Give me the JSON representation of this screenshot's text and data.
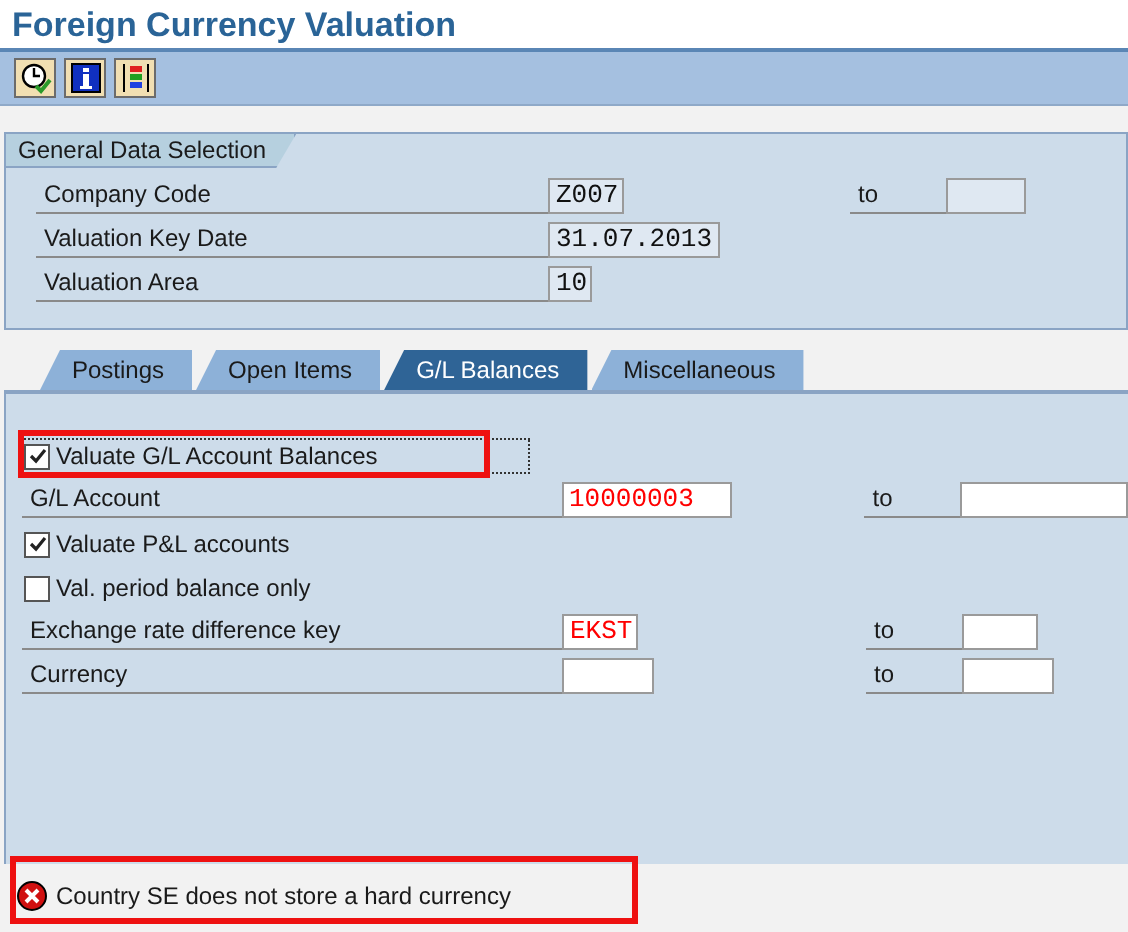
{
  "title": "Foreign Currency Valuation",
  "toolbar": [
    {
      "kind": "execute"
    },
    {
      "kind": "info"
    },
    {
      "kind": "layout"
    }
  ],
  "general_data_selection": {
    "title": "General Data Selection",
    "rows": [
      {
        "label": "Company Code",
        "value": "Z007",
        "to": {
          "label": "to"
        }
      },
      {
        "label": "Valuation Key Date",
        "value": "31.07.2013"
      },
      {
        "label": "Valuation Area",
        "value": "10"
      }
    ]
  },
  "tabs": [
    {
      "label": "Postings",
      "selected": false
    },
    {
      "label": "Open Items",
      "selected": false
    },
    {
      "label": "G/L Balances",
      "selected": true
    },
    {
      "label": "Miscellaneous",
      "selected": false
    }
  ],
  "gl_balances": [
    {
      "kind": "checkbox",
      "label": "Valuate G/L Account Balances",
      "checked": true,
      "annotated": true,
      "focused": true
    },
    {
      "kind": "field",
      "label": "G/L Account",
      "value": "10000003",
      "flagged": true,
      "to": {
        "label": "to"
      }
    },
    {
      "kind": "checkbox",
      "label": "Valuate P&L accounts",
      "checked": true,
      "annotated": false,
      "focused": false
    },
    {
      "kind": "checkbox",
      "label": "Val. period balance only",
      "checked": false,
      "annotated": false,
      "focused": false
    },
    {
      "kind": "field",
      "label": "Exchange rate difference key",
      "value": "EKST",
      "flagged": true,
      "to": {
        "label": "to"
      }
    },
    {
      "kind": "field",
      "label": "Currency",
      "to": {
        "label": "to"
      }
    }
  ],
  "status": {
    "error": true,
    "text": "Country SE does not store a hard currency",
    "annotated": true
  }
}
